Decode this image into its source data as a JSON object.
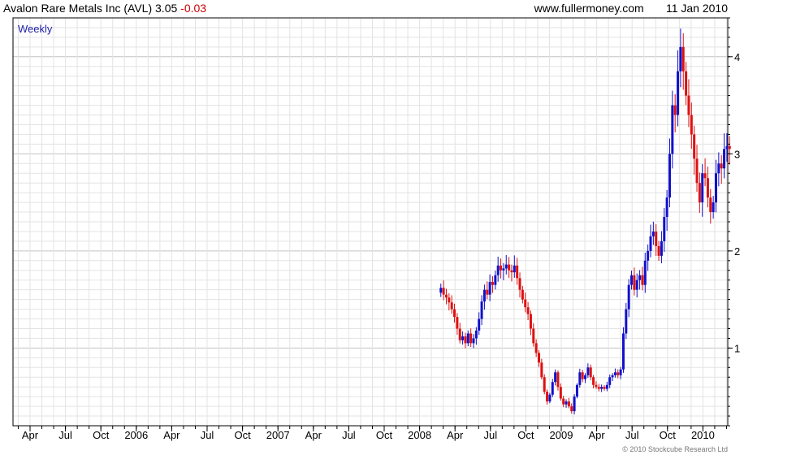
{
  "header": {
    "title": "Avalon Rare Metals Inc (AVL)",
    "last": "3.05",
    "change": "-0.03",
    "site": "www.fullermoney.com",
    "date": "11 Jan 2010"
  },
  "chart_data": {
    "type": "candlestick",
    "period_label": "Weekly",
    "copyright": "© 2010 Stockcube Research Ltd",
    "ylim": [
      0.2,
      4.4
    ],
    "y_ticks": [
      1,
      2,
      3,
      4
    ],
    "x_ticks": [
      {
        "label": "Apr",
        "i": 0
      },
      {
        "label": "Jul",
        "i": 1
      },
      {
        "label": "Oct",
        "i": 2
      },
      {
        "label": "2006",
        "i": 3
      },
      {
        "label": "Apr",
        "i": 4
      },
      {
        "label": "Jul",
        "i": 5
      },
      {
        "label": "Oct",
        "i": 6
      },
      {
        "label": "2007",
        "i": 7
      },
      {
        "label": "Apr",
        "i": 8
      },
      {
        "label": "Jul",
        "i": 9
      },
      {
        "label": "Oct",
        "i": 10
      },
      {
        "label": "2008",
        "i": 11
      },
      {
        "label": "Apr",
        "i": 12
      },
      {
        "label": "Jul",
        "i": 13
      },
      {
        "label": "Oct",
        "i": 14
      },
      {
        "label": "2009",
        "i": 15
      },
      {
        "label": "Apr",
        "i": 16
      },
      {
        "label": "Jul",
        "i": 17
      },
      {
        "label": "Oct",
        "i": 18
      },
      {
        "label": "2010",
        "i": 19
      }
    ],
    "series_start_quarter": 11.6,
    "weeks_per_quarter": 13,
    "colors": {
      "up": "#1111cc",
      "down": "#dd1111",
      "grid": "#e3e3e3",
      "grid_major": "#c8c8c8",
      "axis": "#000000"
    },
    "closes": [
      1.62,
      1.55,
      1.52,
      1.47,
      1.4,
      1.32,
      1.2,
      1.08,
      1.12,
      1.05,
      1.15,
      1.05,
      1.1,
      1.18,
      1.3,
      1.48,
      1.6,
      1.55,
      1.68,
      1.65,
      1.75,
      1.85,
      1.8,
      1.82,
      1.86,
      1.8,
      1.78,
      1.85,
      1.72,
      1.6,
      1.5,
      1.42,
      1.35,
      1.2,
      1.05,
      0.95,
      0.85,
      0.7,
      0.55,
      0.45,
      0.52,
      0.65,
      0.75,
      0.6,
      0.48,
      0.42,
      0.45,
      0.4,
      0.35,
      0.5,
      0.62,
      0.75,
      0.68,
      0.72,
      0.8,
      0.7,
      0.62,
      0.6,
      0.58,
      0.6,
      0.58,
      0.62,
      0.7,
      0.72,
      0.75,
      0.72,
      0.78,
      1.15,
      1.4,
      1.65,
      1.75,
      1.6,
      1.7,
      1.75,
      1.65,
      1.9,
      2.0,
      2.15,
      2.2,
      2.05,
      1.95,
      2.1,
      2.35,
      2.55,
      3.0,
      3.5,
      3.4,
      3.85,
      4.1,
      3.85,
      3.6,
      3.4,
      3.2,
      2.95,
      2.7,
      2.5,
      2.8,
      2.75,
      2.55,
      2.4,
      2.5,
      2.8,
      2.9,
      2.85,
      3.05,
      3.08,
      3.05
    ]
  }
}
